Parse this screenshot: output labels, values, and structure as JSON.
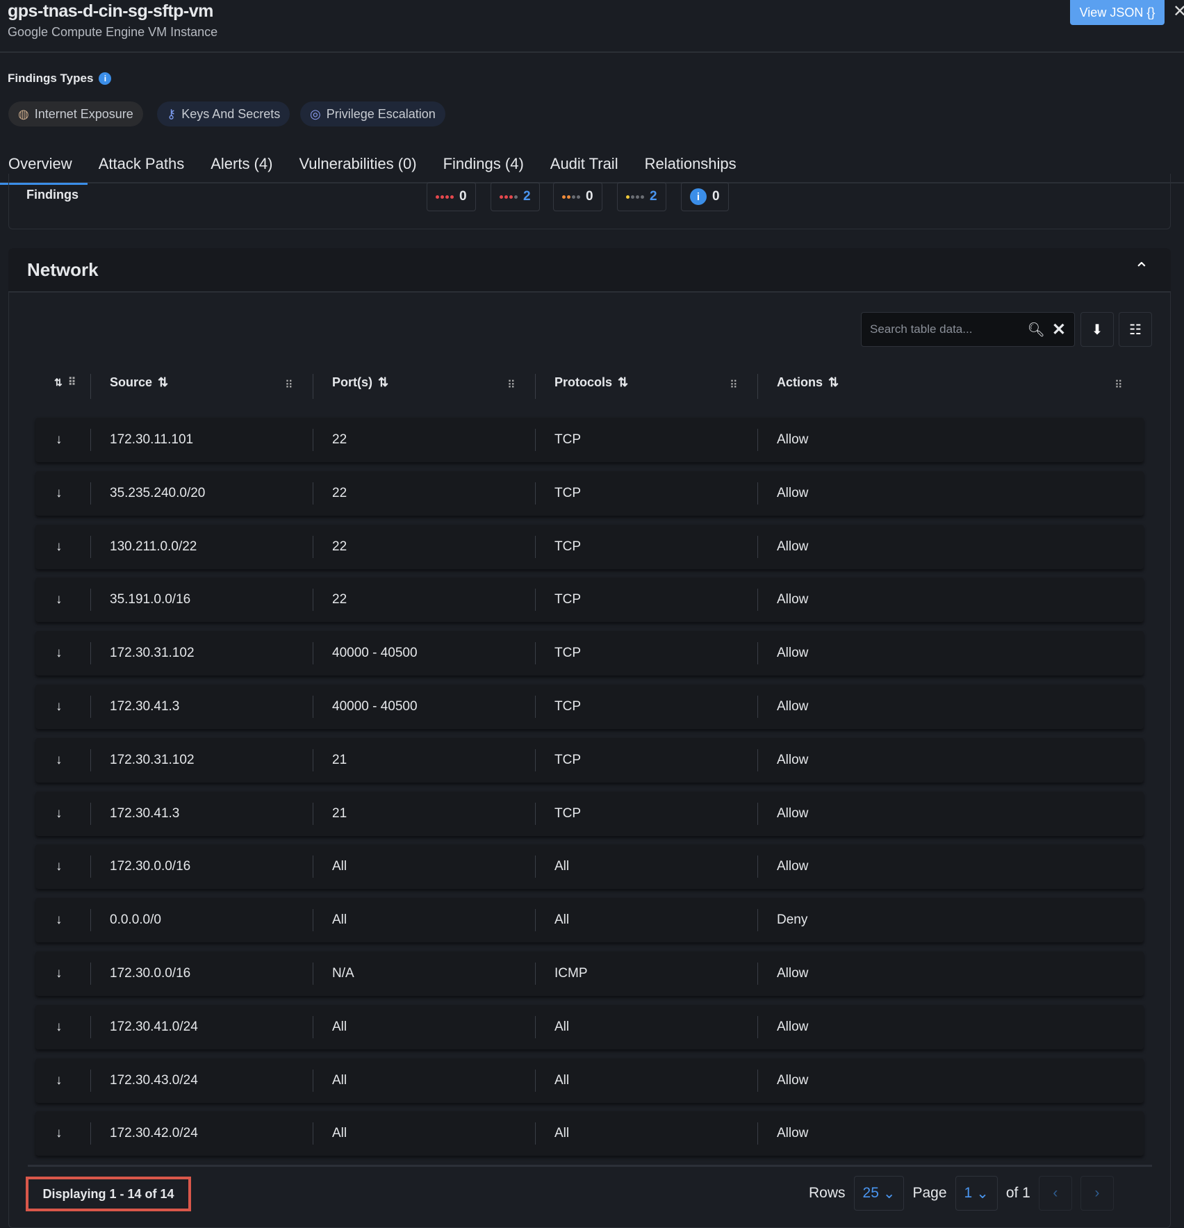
{
  "header": {
    "title": "gps-tnas-d-cin-sg-sftp-vm",
    "subtitle": "Google Compute Engine VM Instance",
    "view_json": "View JSON {}",
    "close": "✕"
  },
  "findings_types": {
    "label": "Findings Types",
    "chips": [
      {
        "label": "Internet Exposure",
        "icon": "globe-icon"
      },
      {
        "label": "Keys And Secrets",
        "icon": "key-icon"
      },
      {
        "label": "Privilege Escalation",
        "icon": "fingerprint-icon"
      }
    ]
  },
  "tabs": [
    "Overview",
    "Attack Paths",
    "Alerts (4)",
    "Vulnerabilities (0)",
    "Findings (4)",
    "Audit Trail",
    "Relationships"
  ],
  "findings": {
    "label": "Findings",
    "severities": [
      {
        "name": "critical",
        "count": "0",
        "color": "#e5484d",
        "filled": 4
      },
      {
        "name": "high",
        "count": "2",
        "color": "#e5484d",
        "filled": 3
      },
      {
        "name": "medium",
        "count": "0",
        "color": "#f08c3a",
        "filled": 2
      },
      {
        "name": "low",
        "count": "2",
        "color": "#f0c93a",
        "filled": 1
      },
      {
        "name": "info",
        "count": "0"
      }
    ]
  },
  "network": {
    "title": "Network",
    "search_placeholder": "Search table data...",
    "columns": [
      "Source",
      "Port(s)",
      "Protocols",
      "Actions"
    ],
    "rows": [
      [
        "172.30.11.101",
        "22",
        "TCP",
        "Allow"
      ],
      [
        "35.235.240.0/20",
        "22",
        "TCP",
        "Allow"
      ],
      [
        "130.211.0.0/22",
        "22",
        "TCP",
        "Allow"
      ],
      [
        "35.191.0.0/16",
        "22",
        "TCP",
        "Allow"
      ],
      [
        "172.30.31.102",
        "40000 - 40500",
        "TCP",
        "Allow"
      ],
      [
        "172.30.41.3",
        "40000 - 40500",
        "TCP",
        "Allow"
      ],
      [
        "172.30.31.102",
        "21",
        "TCP",
        "Allow"
      ],
      [
        "172.30.41.3",
        "21",
        "TCP",
        "Allow"
      ],
      [
        "172.30.0.0/16",
        "All",
        "All",
        "Allow"
      ],
      [
        "0.0.0.0/0",
        "All",
        "All",
        "Deny"
      ],
      [
        "172.30.0.0/16",
        "N/A",
        "ICMP",
        "Allow"
      ],
      [
        "172.30.41.0/24",
        "All",
        "All",
        "Allow"
      ],
      [
        "172.30.43.0/24",
        "All",
        "All",
        "Allow"
      ],
      [
        "172.30.42.0/24",
        "All",
        "All",
        "Allow"
      ]
    ]
  },
  "pagination": {
    "displaying": "Displaying 1 - 14 of 14",
    "rows_label": "Rows",
    "rows_value": "25",
    "page_label": "Page",
    "page_value": "1",
    "of_label": "of 1"
  }
}
